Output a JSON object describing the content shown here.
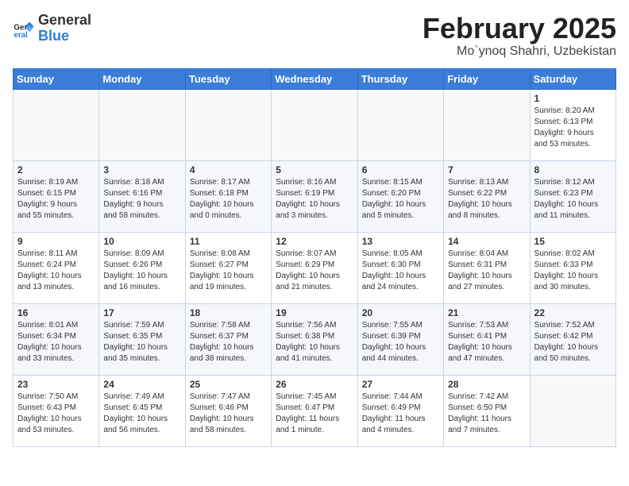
{
  "header": {
    "logo_general": "General",
    "logo_blue": "Blue",
    "title": "February 2025",
    "subtitle": "Mo`ynoq Shahri, Uzbekistan"
  },
  "calendar": {
    "days_of_week": [
      "Sunday",
      "Monday",
      "Tuesday",
      "Wednesday",
      "Thursday",
      "Friday",
      "Saturday"
    ],
    "weeks": [
      [
        {
          "day": "",
          "info": ""
        },
        {
          "day": "",
          "info": ""
        },
        {
          "day": "",
          "info": ""
        },
        {
          "day": "",
          "info": ""
        },
        {
          "day": "",
          "info": ""
        },
        {
          "day": "",
          "info": ""
        },
        {
          "day": "1",
          "info": "Sunrise: 8:20 AM\nSunset: 6:13 PM\nDaylight: 9 hours\nand 53 minutes."
        }
      ],
      [
        {
          "day": "2",
          "info": "Sunrise: 8:19 AM\nSunset: 6:15 PM\nDaylight: 9 hours\nand 55 minutes."
        },
        {
          "day": "3",
          "info": "Sunrise: 8:18 AM\nSunset: 6:16 PM\nDaylight: 9 hours\nand 58 minutes."
        },
        {
          "day": "4",
          "info": "Sunrise: 8:17 AM\nSunset: 6:18 PM\nDaylight: 10 hours\nand 0 minutes."
        },
        {
          "day": "5",
          "info": "Sunrise: 8:16 AM\nSunset: 6:19 PM\nDaylight: 10 hours\nand 3 minutes."
        },
        {
          "day": "6",
          "info": "Sunrise: 8:15 AM\nSunset: 6:20 PM\nDaylight: 10 hours\nand 5 minutes."
        },
        {
          "day": "7",
          "info": "Sunrise: 8:13 AM\nSunset: 6:22 PM\nDaylight: 10 hours\nand 8 minutes."
        },
        {
          "day": "8",
          "info": "Sunrise: 8:12 AM\nSunset: 6:23 PM\nDaylight: 10 hours\nand 11 minutes."
        }
      ],
      [
        {
          "day": "9",
          "info": "Sunrise: 8:11 AM\nSunset: 6:24 PM\nDaylight: 10 hours\nand 13 minutes."
        },
        {
          "day": "10",
          "info": "Sunrise: 8:09 AM\nSunset: 6:26 PM\nDaylight: 10 hours\nand 16 minutes."
        },
        {
          "day": "11",
          "info": "Sunrise: 8:08 AM\nSunset: 6:27 PM\nDaylight: 10 hours\nand 19 minutes."
        },
        {
          "day": "12",
          "info": "Sunrise: 8:07 AM\nSunset: 6:29 PM\nDaylight: 10 hours\nand 21 minutes."
        },
        {
          "day": "13",
          "info": "Sunrise: 8:05 AM\nSunset: 6:30 PM\nDaylight: 10 hours\nand 24 minutes."
        },
        {
          "day": "14",
          "info": "Sunrise: 8:04 AM\nSunset: 6:31 PM\nDaylight: 10 hours\nand 27 minutes."
        },
        {
          "day": "15",
          "info": "Sunrise: 8:02 AM\nSunset: 6:33 PM\nDaylight: 10 hours\nand 30 minutes."
        }
      ],
      [
        {
          "day": "16",
          "info": "Sunrise: 8:01 AM\nSunset: 6:34 PM\nDaylight: 10 hours\nand 33 minutes."
        },
        {
          "day": "17",
          "info": "Sunrise: 7:59 AM\nSunset: 6:35 PM\nDaylight: 10 hours\nand 35 minutes."
        },
        {
          "day": "18",
          "info": "Sunrise: 7:58 AM\nSunset: 6:37 PM\nDaylight: 10 hours\nand 38 minutes."
        },
        {
          "day": "19",
          "info": "Sunrise: 7:56 AM\nSunset: 6:38 PM\nDaylight: 10 hours\nand 41 minutes."
        },
        {
          "day": "20",
          "info": "Sunrise: 7:55 AM\nSunset: 6:39 PM\nDaylight: 10 hours\nand 44 minutes."
        },
        {
          "day": "21",
          "info": "Sunrise: 7:53 AM\nSunset: 6:41 PM\nDaylight: 10 hours\nand 47 minutes."
        },
        {
          "day": "22",
          "info": "Sunrise: 7:52 AM\nSunset: 6:42 PM\nDaylight: 10 hours\nand 50 minutes."
        }
      ],
      [
        {
          "day": "23",
          "info": "Sunrise: 7:50 AM\nSunset: 6:43 PM\nDaylight: 10 hours\nand 53 minutes."
        },
        {
          "day": "24",
          "info": "Sunrise: 7:49 AM\nSunset: 6:45 PM\nDaylight: 10 hours\nand 56 minutes."
        },
        {
          "day": "25",
          "info": "Sunrise: 7:47 AM\nSunset: 6:46 PM\nDaylight: 10 hours\nand 58 minutes."
        },
        {
          "day": "26",
          "info": "Sunrise: 7:45 AM\nSunset: 6:47 PM\nDaylight: 11 hours\nand 1 minute."
        },
        {
          "day": "27",
          "info": "Sunrise: 7:44 AM\nSunset: 6:49 PM\nDaylight: 11 hours\nand 4 minutes."
        },
        {
          "day": "28",
          "info": "Sunrise: 7:42 AM\nSunset: 6:50 PM\nDaylight: 11 hours\nand 7 minutes."
        },
        {
          "day": "",
          "info": ""
        }
      ]
    ]
  }
}
